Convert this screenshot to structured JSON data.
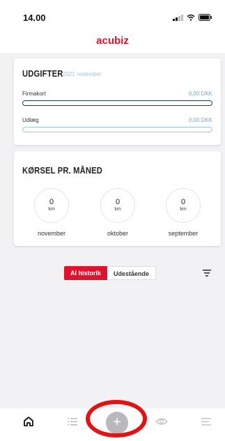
{
  "status_bar": {
    "time": "14.00",
    "icons": [
      "signal-icon",
      "wifi-icon",
      "battery-icon"
    ]
  },
  "header": {
    "brand": "acubiz",
    "brand_color": "#e0122e"
  },
  "expenses_card": {
    "title": "UDGIFTER",
    "subtitle": "2021 november",
    "rows": [
      {
        "label": "Firmakort",
        "value": "0,00 DKK",
        "progress": 0
      },
      {
        "label": "Udlæg",
        "value": "0,00 DKK",
        "progress": 0
      }
    ]
  },
  "mileage_card": {
    "title": "KØRSEL PR. MÅNED",
    "months": [
      {
        "value": "0",
        "unit": "km",
        "label": "november"
      },
      {
        "value": "0",
        "unit": "km",
        "label": "oktober"
      },
      {
        "value": "0",
        "unit": "km",
        "label": "september"
      }
    ]
  },
  "history_filter": {
    "segments": [
      "Al historik",
      "Udestående"
    ],
    "selected": "Al historik"
  },
  "tab_bar": {
    "tabs": [
      "home-icon",
      "list-icon",
      "add-icon",
      "eye-icon",
      "menu-icon"
    ],
    "add_label": "+"
  }
}
